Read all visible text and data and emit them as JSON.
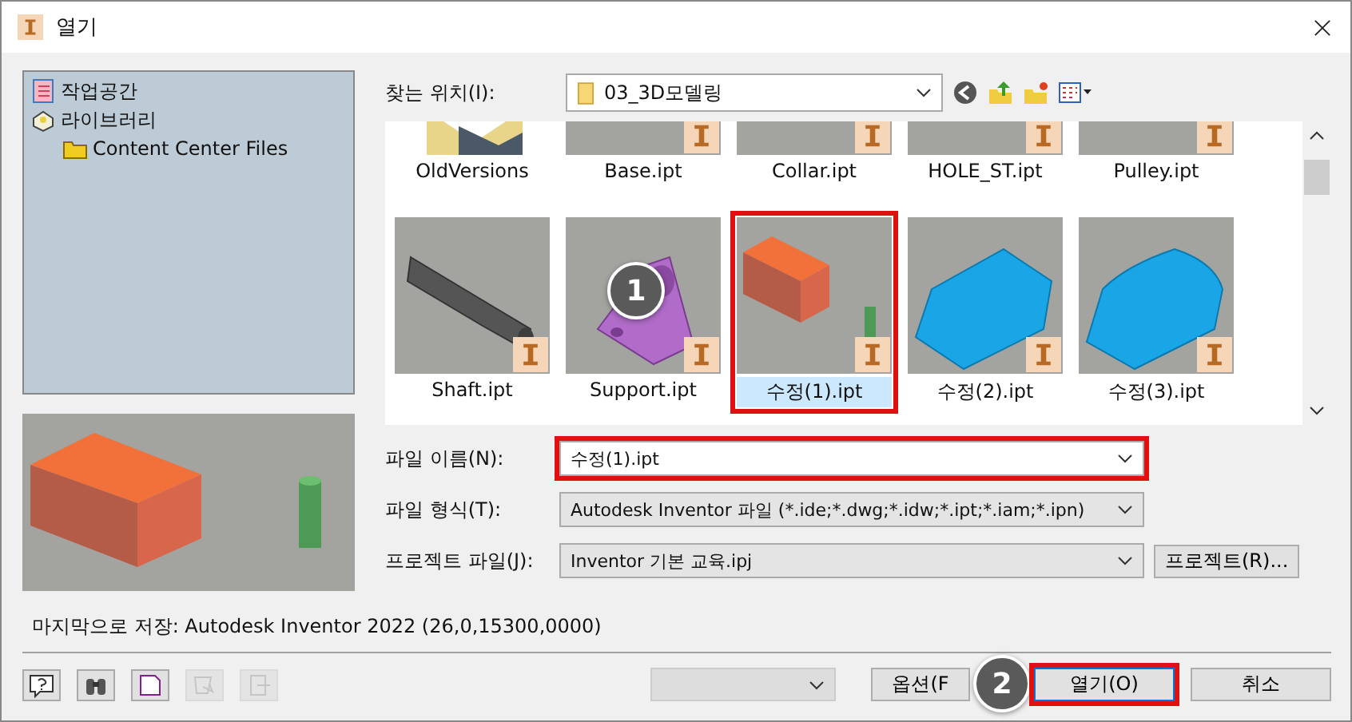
{
  "window": {
    "title": "열기"
  },
  "places": [
    {
      "label": "작업공간",
      "kind": "workspace"
    },
    {
      "label": "라이브러리",
      "kind": "library",
      "children": [
        {
          "label": "Content Center Files",
          "kind": "folder"
        }
      ]
    }
  ],
  "location": {
    "label": "찾는 위치(I):",
    "value": "03_3D모델링"
  },
  "files": [
    [
      {
        "name": "OldVersions",
        "kind": "folder",
        "selected": false,
        "highlighted": false
      },
      {
        "name": "Base.ipt",
        "kind": "blank",
        "selected": false,
        "highlighted": false
      },
      {
        "name": "Collar.ipt",
        "kind": "blank",
        "selected": false,
        "highlighted": false
      },
      {
        "name": "HOLE_ST.ipt",
        "kind": "blank",
        "selected": false,
        "highlighted": false
      },
      {
        "name": "Pulley.ipt",
        "kind": "blank",
        "selected": false,
        "highlighted": false
      }
    ],
    [
      {
        "name": "Shaft.ipt",
        "kind": "shaft",
        "selected": false,
        "highlighted": false
      },
      {
        "name": "Support.ipt",
        "kind": "support",
        "selected": false,
        "highlighted": false,
        "callout": "1"
      },
      {
        "name": "수정(1).ipt",
        "kind": "box",
        "selected": true,
        "highlighted": true
      },
      {
        "name": "수정(2).ipt",
        "kind": "trapezoid",
        "selected": false,
        "highlighted": false
      },
      {
        "name": "수정(3).ipt",
        "kind": "rounded",
        "selected": false,
        "highlighted": false
      }
    ]
  ],
  "fields": [
    {
      "label": "파일 이름(N):",
      "value": "수정(1).ipt",
      "editable": true,
      "highlighted": true
    },
    {
      "label": "파일 형식(T):",
      "value": "Autodesk Inventor 파일 (*.ide;*.dwg;*.idw;*.ipt;*.iam;*.ipn)",
      "editable": false,
      "highlighted": false
    },
    {
      "label": "프로젝트 파일(J):",
      "value": "Inventor 기본 교육.ipj",
      "editable": false,
      "highlighted": false,
      "button": "프로젝트(R)..."
    }
  ],
  "status": "마지막으로 저장: Autodesk Inventor 2022 (26,0,15300,0000)",
  "tools": [
    {
      "kind": "help",
      "disabled": false
    },
    {
      "kind": "find",
      "disabled": false
    },
    {
      "kind": "new",
      "disabled": false
    },
    {
      "kind": "import",
      "disabled": true
    },
    {
      "kind": "export",
      "disabled": true
    }
  ],
  "buttons": [
    {
      "label": "옵션(F",
      "highlighted": false,
      "callout": "2"
    },
    {
      "label": "열기(O)",
      "highlighted": true
    },
    {
      "label": "취소",
      "highlighted": false
    }
  ]
}
